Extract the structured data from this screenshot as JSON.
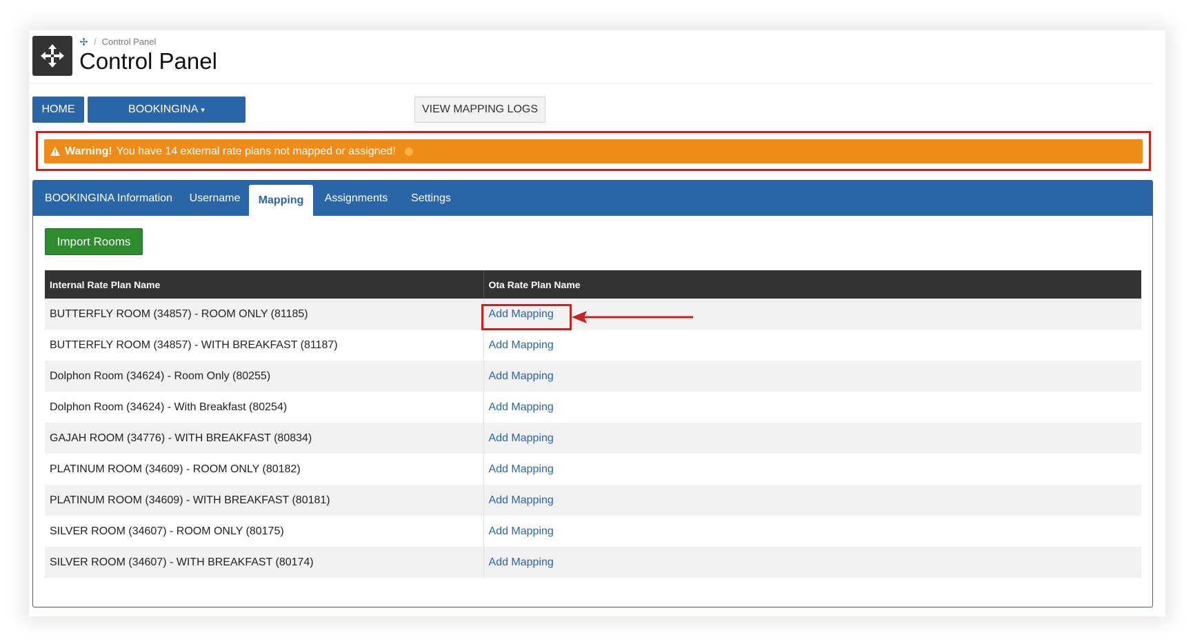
{
  "breadcrumb": {
    "label": "Control Panel"
  },
  "page": {
    "title": "Control Panel"
  },
  "toolbar": {
    "home_label": "HOME",
    "channel_label": "BOOKINGINA",
    "logs_label": "VIEW MAPPING LOGS"
  },
  "warning": {
    "strong": "Warning!",
    "message": "You have 14 external rate plans not mapped or assigned!"
  },
  "tabs": [
    {
      "label": "BOOKINGINA Information",
      "active": false
    },
    {
      "label": "Username",
      "active": false
    },
    {
      "label": "Mapping",
      "active": true
    },
    {
      "label": "Assignments",
      "active": false
    },
    {
      "label": "Settings",
      "active": false
    }
  ],
  "mapping": {
    "import_label": "Import Rooms",
    "columns": [
      "Internal Rate Plan Name",
      "Ota Rate Plan Name"
    ],
    "rows": [
      {
        "internal": "BUTTERFLY ROOM (34857) - ROOM ONLY (81185)",
        "action": "Add Mapping"
      },
      {
        "internal": "BUTTERFLY ROOM (34857) - WITH BREAKFAST (81187)",
        "action": "Add Mapping"
      },
      {
        "internal": "Dolphon Room (34624) - Room Only (80255)",
        "action": "Add Mapping"
      },
      {
        "internal": "Dolphon Room (34624) - With Breakfast (80254)",
        "action": "Add Mapping"
      },
      {
        "internal": "GAJAH ROOM (34776) - WITH BREAKFAST (80834)",
        "action": "Add Mapping"
      },
      {
        "internal": "PLATINUM ROOM (34609) - ROOM ONLY (80182)",
        "action": "Add Mapping"
      },
      {
        "internal": "PLATINUM ROOM (34609) - WITH BREAKFAST (80181)",
        "action": "Add Mapping"
      },
      {
        "internal": "SILVER ROOM (34607) - ROOM ONLY (80175)",
        "action": "Add Mapping"
      },
      {
        "internal": "SILVER ROOM (34607) - WITH BREAKFAST (80174)",
        "action": "Add Mapping"
      }
    ]
  },
  "colors": {
    "primary": "#2a66a7",
    "warning": "#ef8b17",
    "success": "#2d8c2d",
    "header_dark": "#333333",
    "highlight": "#cc1f1f"
  }
}
